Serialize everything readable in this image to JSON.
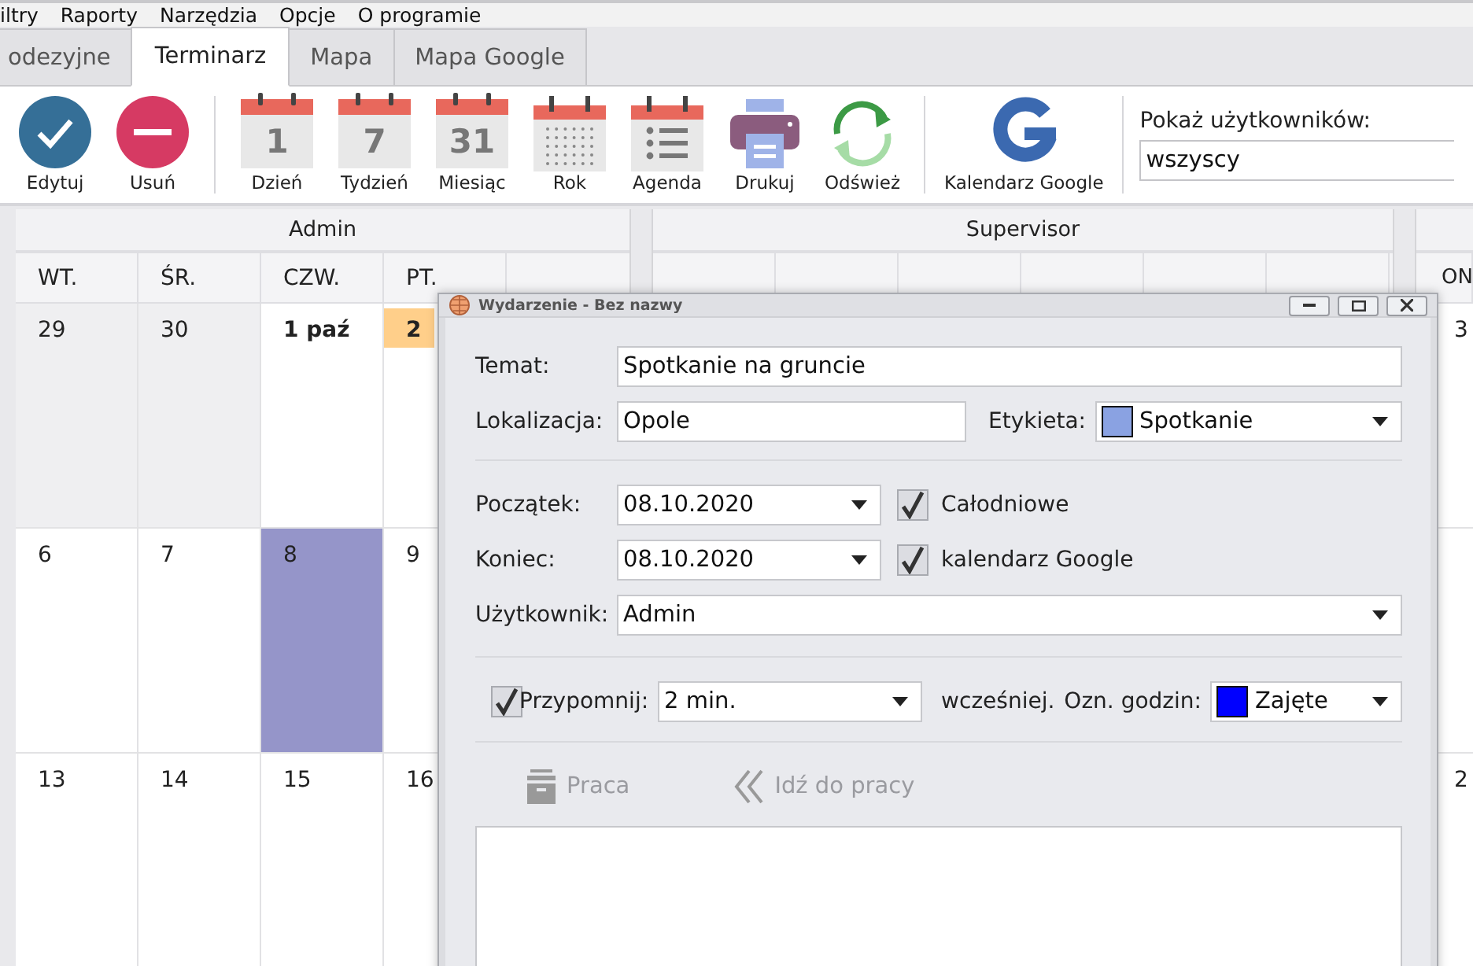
{
  "menu": [
    {
      "label": "iltry"
    },
    {
      "label": "Raporty"
    },
    {
      "label": "Narzędzia"
    },
    {
      "label": "Opcje"
    },
    {
      "label": "O programie"
    }
  ],
  "tabs": [
    {
      "label": "odezyjne",
      "selected": false
    },
    {
      "label": "Terminarz",
      "selected": true
    },
    {
      "label": "Mapa",
      "selected": false
    },
    {
      "label": "Mapa Google",
      "selected": false
    }
  ],
  "toolbar": {
    "groups": [
      [
        {
          "kind": "edit",
          "label": "Edytuj"
        },
        {
          "kind": "delete",
          "label": "Usuń"
        }
      ],
      [
        {
          "kind": "calendar",
          "number": "1",
          "label": "Dzień"
        },
        {
          "kind": "calendar",
          "number": "7",
          "label": "Tydzień"
        },
        {
          "kind": "calendar",
          "number": "31",
          "label": "Miesiąc"
        },
        {
          "kind": "grid",
          "label": "Rok"
        },
        {
          "kind": "list",
          "label": "Agenda"
        },
        {
          "kind": "print",
          "label": "Drukuj"
        },
        {
          "kind": "refresh",
          "label": "Odśwież"
        }
      ],
      [
        {
          "kind": "google",
          "label": "Kalendarz Google"
        }
      ]
    ],
    "user_filter": {
      "label": "Pokaż użytkowników:",
      "value": "wszyscy"
    }
  },
  "calendar": {
    "admin": {
      "name": "Admin",
      "columns": [
        "WT.",
        "ŚR.",
        "CZW.",
        "PT."
      ]
    },
    "supervisor": {
      "name": "Supervisor"
    },
    "edge_header": "ON",
    "weeks": [
      {
        "days": [
          {
            "day": "29",
            "kind": "outside"
          },
          {
            "day": "30",
            "kind": "outside"
          },
          {
            "day": "1 paź",
            "kind": "month_start"
          },
          {
            "day": "2",
            "kind": "today"
          }
        ],
        "edge_day": "3"
      },
      {
        "days": [
          {
            "day": "6",
            "kind": "normal"
          },
          {
            "day": "7",
            "kind": "normal"
          },
          {
            "day": "8",
            "kind": "event"
          },
          {
            "day": "9",
            "kind": "normal"
          }
        ]
      },
      {
        "days": [
          {
            "day": "13",
            "kind": "normal"
          },
          {
            "day": "14",
            "kind": "normal"
          },
          {
            "day": "15",
            "kind": "normal"
          },
          {
            "day": "16",
            "kind": "normal"
          }
        ],
        "edge_day": "2"
      }
    ]
  },
  "dialog": {
    "title": "Wydarzenie - Bez nazwy",
    "subject": {
      "label": "Temat:",
      "value": "Spotkanie na gruncie"
    },
    "location": {
      "label": "Lokalizacja:",
      "value": "Opole"
    },
    "tag": {
      "label": "Etykieta:",
      "value": "Spotkanie",
      "color": "#8aa2e2"
    },
    "start": {
      "label": "Początek:",
      "value": "08.10.2020"
    },
    "all_day": {
      "label": "Całodniowe",
      "checked": true
    },
    "end": {
      "label": "Koniec:",
      "value": "08.10.2020"
    },
    "google_sync": {
      "label": "kalendarz Google",
      "checked": true
    },
    "user": {
      "label": "Użytkownik:",
      "value": "Admin"
    },
    "reminder": {
      "label": "Przypomnij:",
      "checked": true,
      "value": "2 min.",
      "suffix": "wcześniej."
    },
    "show_time_as": {
      "label": "Ozn. godzin:",
      "value": "Zajęte",
      "color": "#0000ff"
    },
    "actions": [
      {
        "kind": "work",
        "label": "Praca",
        "disabled": true
      },
      {
        "kind": "go",
        "label": "Idź do pracy",
        "disabled": true
      }
    ]
  }
}
